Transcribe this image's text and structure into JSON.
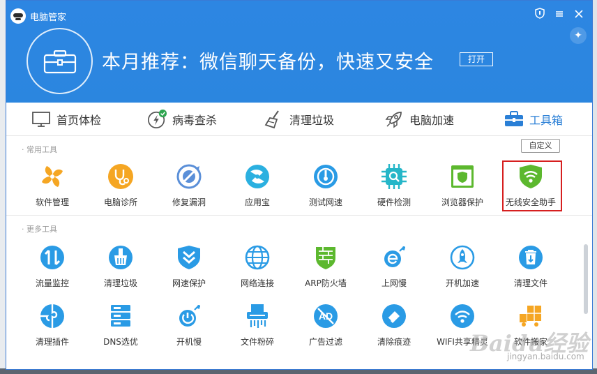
{
  "window": {
    "app_title": "电脑管家",
    "controls": [
      "shield-icon",
      "minimize-icon",
      "close-icon"
    ]
  },
  "promo": {
    "text": "本月推荐：微信聊天备份，快速又安全",
    "button": "打开"
  },
  "tabs": [
    {
      "label": "首页体检",
      "icon": "monitor-icon"
    },
    {
      "label": "病毒查杀",
      "icon": "lightning-icon"
    },
    {
      "label": "清理垃圾",
      "icon": "broom-icon"
    },
    {
      "label": "电脑加速",
      "icon": "rocket-icon"
    },
    {
      "label": "工具箱",
      "icon": "toolbox-icon",
      "active": true
    }
  ],
  "sections": {
    "common": {
      "label": "常用工具",
      "customize": "自定义"
    },
    "more": {
      "label": "更多工具"
    }
  },
  "common_tools": [
    {
      "label": "软件管理",
      "icon": "fan-icon",
      "color": "#f5a623"
    },
    {
      "label": "电脑诊所",
      "icon": "stethoscope-icon",
      "color": "#f5a623"
    },
    {
      "label": "修复漏洞",
      "icon": "repair-icon",
      "color": "#5a8fd8"
    },
    {
      "label": "应用宝",
      "icon": "appstore-icon",
      "color": "#2bb0e0"
    },
    {
      "label": "测试网速",
      "icon": "speedtest-icon",
      "color": "#2a9be5"
    },
    {
      "label": "硬件检测",
      "icon": "chip-icon",
      "color": "#25b6c8"
    },
    {
      "label": "浏览器保护",
      "icon": "browser-shield-icon",
      "color": "#5cb82e"
    },
    {
      "label": "无线安全助手",
      "icon": "wifi-shield-icon",
      "color": "#5cb82e"
    }
  ],
  "more_tools_row1": [
    {
      "label": "流量监控",
      "icon": "traffic-icon",
      "color": "#2a9be5"
    },
    {
      "label": "清理垃圾",
      "icon": "broom-icon",
      "color": "#2a9be5"
    },
    {
      "label": "网速保护",
      "icon": "speed-shield-icon",
      "color": "#2a9be5"
    },
    {
      "label": "网络连接",
      "icon": "globe-icon",
      "color": "#2a9be5"
    },
    {
      "label": "ARP防火墙",
      "icon": "firewall-icon",
      "color": "#5cb82e"
    },
    {
      "label": "上网慢",
      "icon": "ie-icon",
      "color": "#2a9be5"
    },
    {
      "label": "开机加速",
      "icon": "boot-rocket-icon",
      "color": "#2a9be5"
    },
    {
      "label": "清理文件",
      "icon": "trash-icon",
      "color": "#2a9be5"
    }
  ],
  "more_tools_row2": [
    {
      "label": "清理插件",
      "icon": "puzzle-icon",
      "color": "#2a9be5"
    },
    {
      "label": "DNS选优",
      "icon": "server-icon",
      "color": "#2a9be5"
    },
    {
      "label": "开机慢",
      "icon": "slow-boot-icon",
      "color": "#2a9be5"
    },
    {
      "label": "文件粉碎",
      "icon": "shredder-icon",
      "color": "#2a9be5"
    },
    {
      "label": "广告过滤",
      "icon": "ad-block-icon",
      "color": "#2a9be5"
    },
    {
      "label": "清除痕迹",
      "icon": "eraser-icon",
      "color": "#2a9be5"
    },
    {
      "label": "WIFI共享精灵",
      "icon": "wifi-share-icon",
      "color": "#2a9be5"
    },
    {
      "label": "软件搬家",
      "icon": "truck-icon",
      "color": "#f5a623"
    }
  ],
  "watermark": {
    "text": "Baidu经验",
    "url": "jingyan.baidu.com"
  }
}
